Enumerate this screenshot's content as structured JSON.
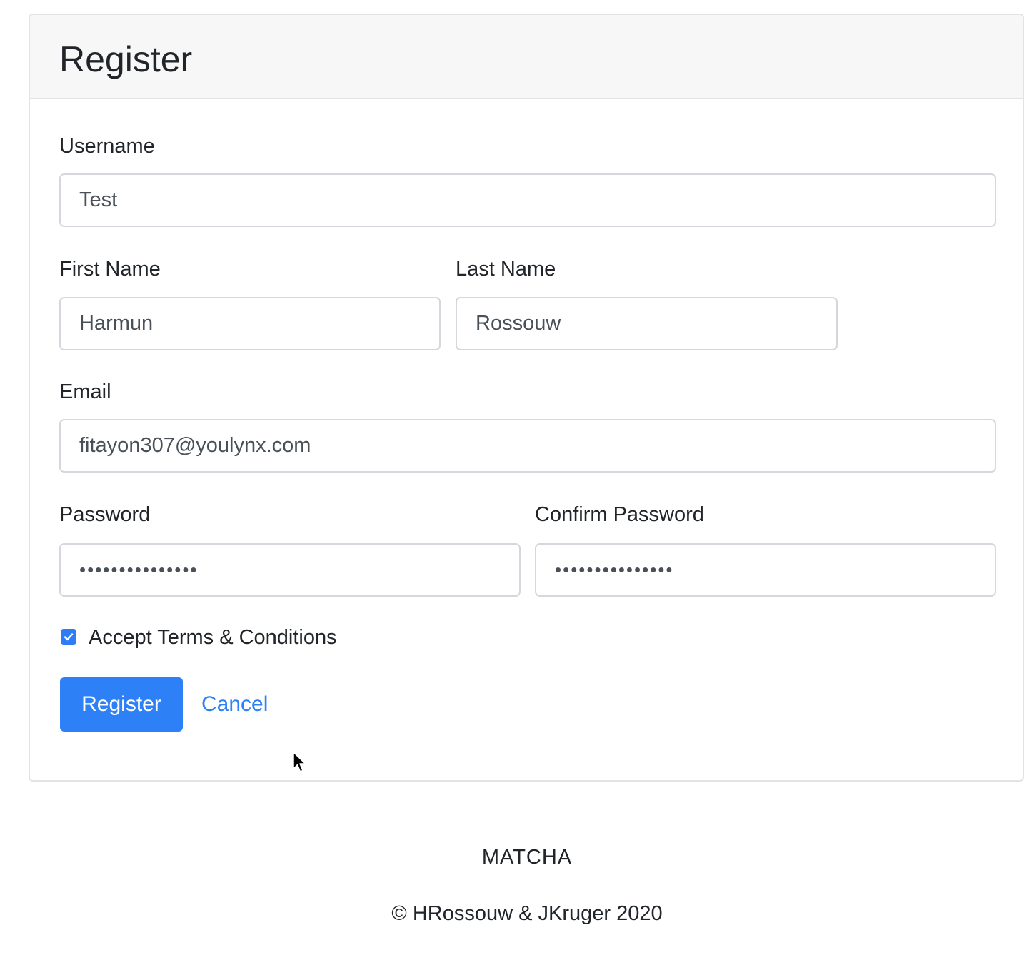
{
  "card": {
    "title": "Register"
  },
  "form": {
    "username": {
      "label": "Username",
      "value": "Test"
    },
    "first_name": {
      "label": "First Name",
      "value": "Harmun"
    },
    "last_name": {
      "label": "Last Name",
      "value": "Rossouw"
    },
    "email": {
      "label": "Email",
      "value": "fitayon307@youlynx.com"
    },
    "password": {
      "label": "Password",
      "masked": "•••••••••••••••"
    },
    "confirm_password": {
      "label": "Confirm Password",
      "masked": "•••••••••••••••"
    },
    "terms": {
      "label": "Accept Terms & Conditions",
      "checked": true
    },
    "register_label": "Register",
    "cancel_label": "Cancel"
  },
  "footer": {
    "brand": "MATCHA",
    "copyright": "© HRossouw & JKruger 2020"
  },
  "colors": {
    "primary": "#2e80f7",
    "header_bg": "#f7f7f7",
    "border": "#e3e3e3"
  }
}
